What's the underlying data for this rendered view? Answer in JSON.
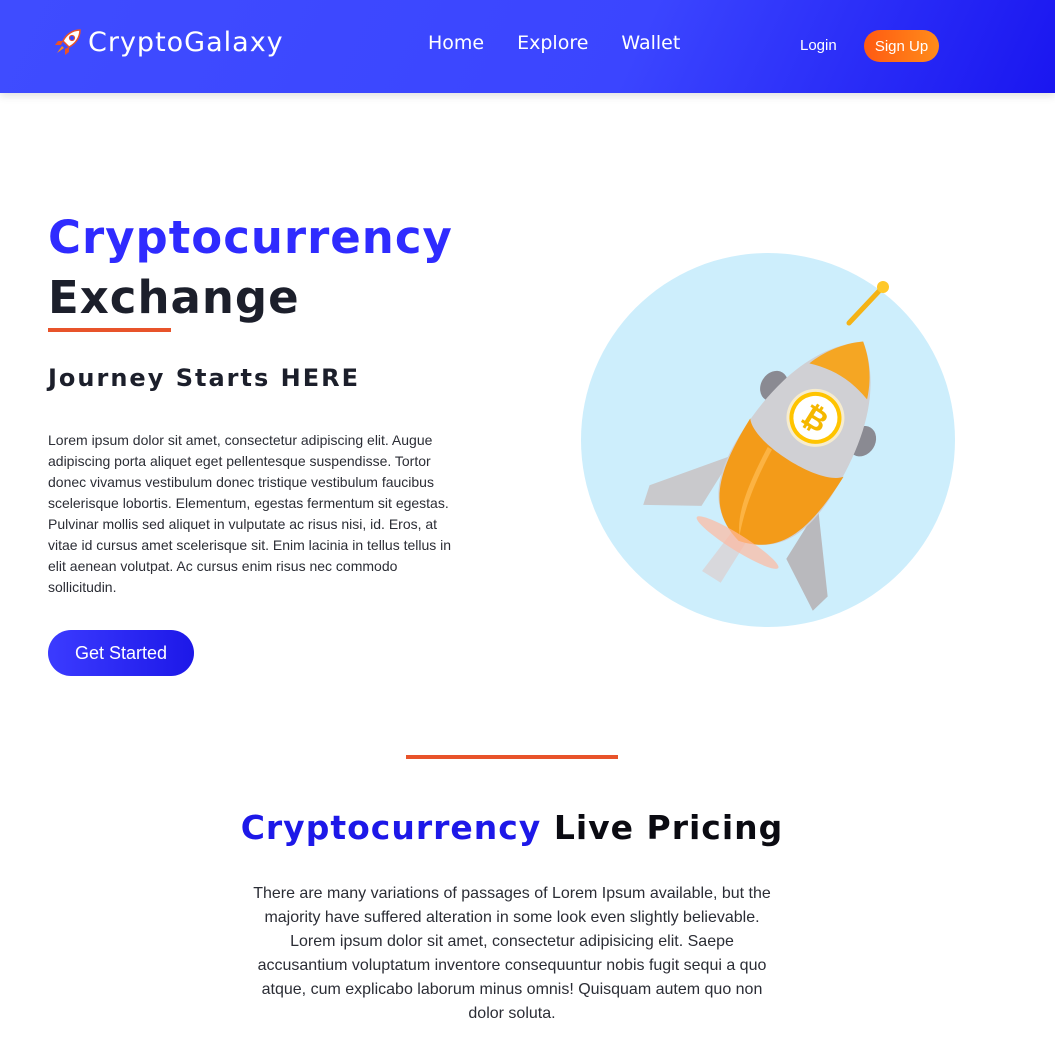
{
  "nav": {
    "brand": "CryptoGalaxy",
    "links": [
      "Home",
      "Explore",
      "Wallet"
    ],
    "login": "Login",
    "signup": "Sign Up"
  },
  "hero": {
    "title_accent": "Cryptocurrency",
    "title_dark": "Exchange",
    "subtitle": "Journey Starts HERE",
    "paragraph": "Lorem ipsum dolor sit amet, consectetur adipiscing elit. Augue adipiscing porta aliquet eget pellentesque suspendisse. Tortor donec vivamus vestibulum donec tristique vestibulum faucibus scelerisque lobortis. Elementum, egestas fermentum sit egestas. Pulvinar mollis sed aliquet in vulputate ac risus nisi, id. Eros, at vitae id cursus amet scelerisque sit. Enim lacinia in tellus tellus in elit aenean volutpat. Ac cursus enim risus nec commodo sollicitudin.",
    "cta": "Get Started"
  },
  "pricing": {
    "title_accent": "Cryptocurrency",
    "title_dark": "Live Pricing",
    "paragraph": "There are many variations of passages of Lorem Ipsum available, but the majority have suffered alteration in some look even slightly believable. Lorem ipsum dolor sit amet, consectetur adipisicing elit. Saepe accusantium voluptatum inventore consequuntur nobis fugit sequi a quo atque, cum explicabo laborum minus omnis! Quisquam autem quo non dolor soluta."
  },
  "colors": {
    "primary": "#3b45ff",
    "accent_orange": "#e8532a",
    "signup_orange": "#ff7a15",
    "circle_bg": "#cdeefc"
  },
  "icons": {
    "logo": "rocket-icon",
    "hero": "rocket-bitcoin-illustration"
  }
}
